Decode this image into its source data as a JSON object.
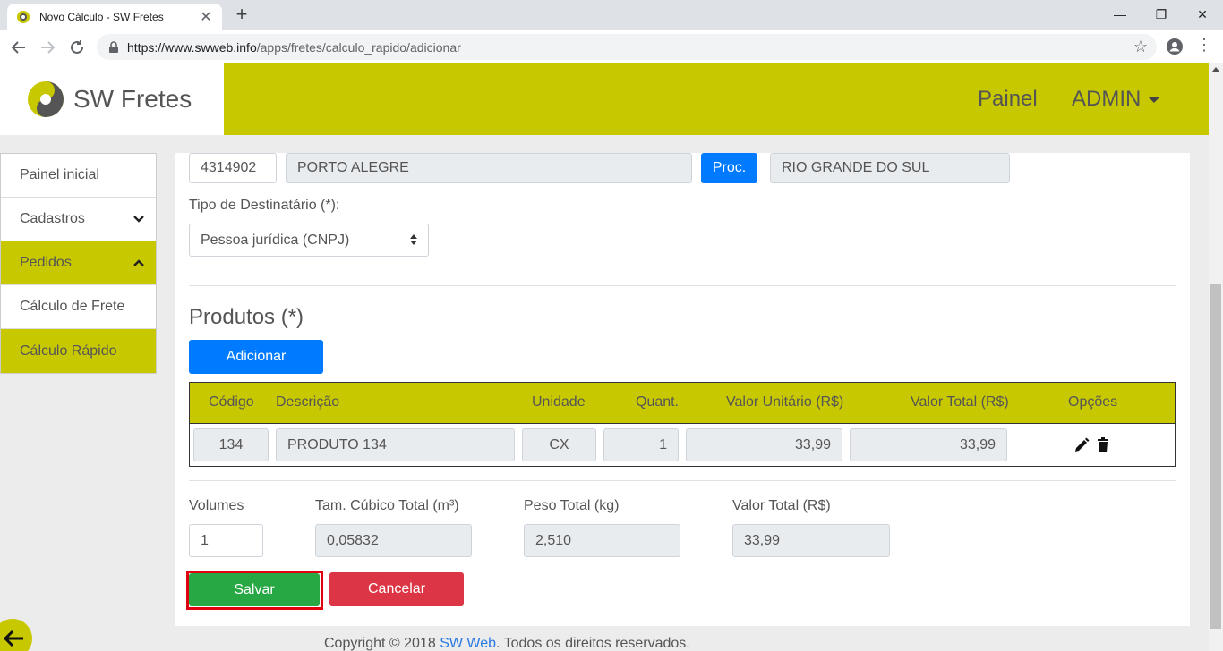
{
  "browser": {
    "tab_title": "Novo Cálculo - SW Fretes",
    "tab_close": "✕",
    "new_tab": "+",
    "minimize": "—",
    "maximize": "❐",
    "close": "✕",
    "url_host": "https://www.swweb.info",
    "url_path": "/apps/fretes/calculo_rapido/adicionar"
  },
  "header": {
    "brand": "SW Fretes",
    "nav_painel": "Painel",
    "nav_admin": "ADMIN"
  },
  "sidebar": {
    "items": [
      {
        "label": "Painel inicial"
      },
      {
        "label": "Cadastros"
      },
      {
        "label": "Pedidos"
      },
      {
        "label": "Cálculo de Frete"
      },
      {
        "label": "Cálculo Rápido"
      }
    ]
  },
  "address": {
    "ibge_code": "4314902",
    "city": "PORTO ALEGRE",
    "proc_button": "Proc.",
    "state": "RIO GRANDE DO SUL"
  },
  "recipient": {
    "label": "Tipo de Destinatário (*):",
    "selected": "Pessoa jurídica (CNPJ)"
  },
  "products": {
    "title": "Produtos (*)",
    "add_button": "Adicionar",
    "headers": {
      "code": "Código",
      "description": "Descrição",
      "unit": "Unidade",
      "qty": "Quant.",
      "unit_value": "Valor Unitário (R$)",
      "total_value": "Valor Total (R$)",
      "options": "Opções"
    },
    "rows": [
      {
        "code": "134",
        "description": "PRODUTO 134",
        "unit": "CX",
        "qty": "1",
        "unit_value": "33,99",
        "total_value": "33,99"
      }
    ]
  },
  "totals": {
    "volumes_label": "Volumes",
    "volumes_value": "1",
    "cubic_label": "Tam. Cúbico Total (m³)",
    "cubic_value": "0,05832",
    "weight_label": "Peso Total (kg)",
    "weight_value": "2,510",
    "value_label": "Valor Total (R$)",
    "value_value": "33,99"
  },
  "actions": {
    "save": "Salvar",
    "cancel": "Cancelar"
  },
  "footer": {
    "prefix": "Copyright © 2018 ",
    "link": "SW Web",
    "suffix": ". Todos os direitos reservados."
  },
  "colors": {
    "accent_yellow": "#c8c800",
    "primary_blue": "#007bff",
    "save_green": "#28a745",
    "cancel_red": "#dc3545",
    "highlight_red": "#e00010"
  }
}
